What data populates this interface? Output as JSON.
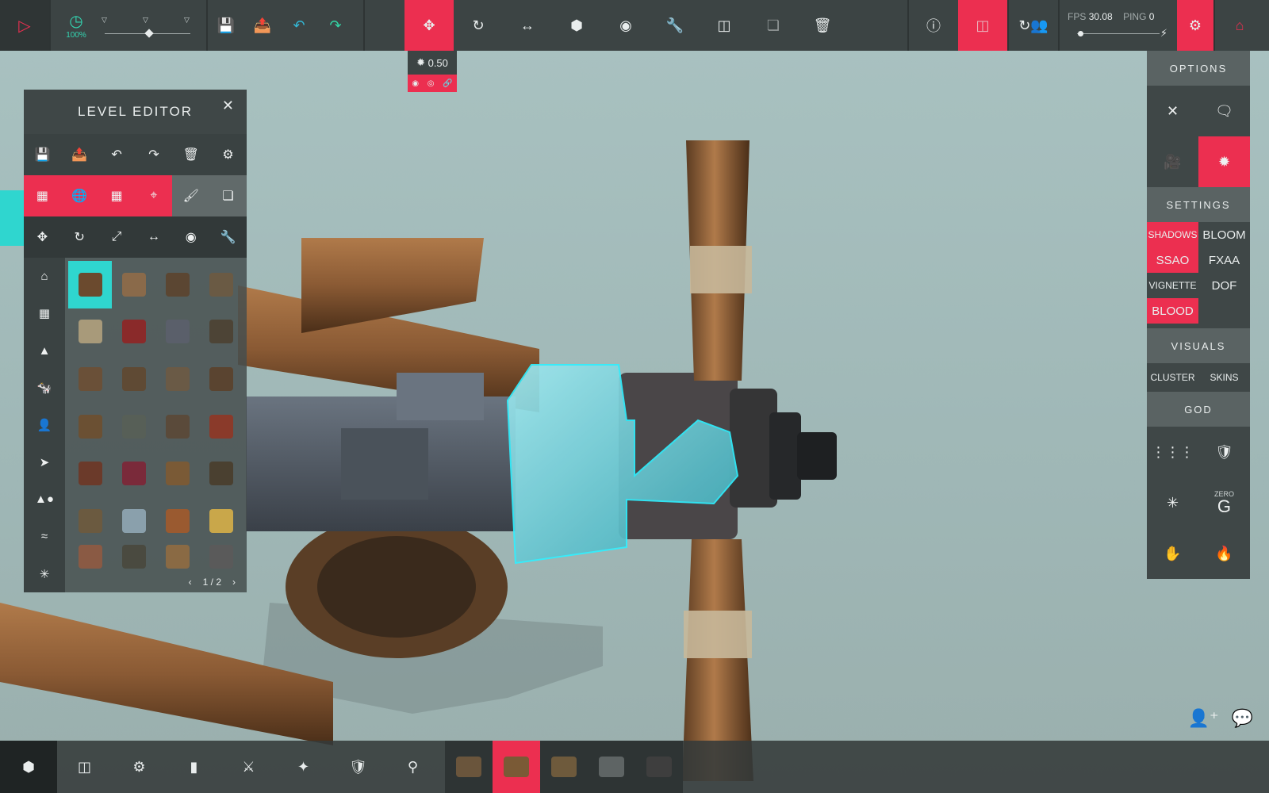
{
  "topbar": {
    "play_icon": "play-icon",
    "time_scale": "100%",
    "scale_value": "0.50",
    "fps_label": "FPS",
    "fps_value": "30.08",
    "ping_label": "PING",
    "ping_value": "0",
    "time_slider_level": 0.5,
    "fps_slider_level": 0.03
  },
  "level_editor": {
    "title": "LEVEL EDITOR",
    "page": "1 / 2"
  },
  "options": {
    "options_header": "OPTIONS",
    "settings_header": "SETTINGS",
    "visuals_header": "VISUALS",
    "god_header": "GOD",
    "shadows": "SHADOWS",
    "bloom": "BLOOM",
    "ssao": "SSAO",
    "fxaa": "FXAA",
    "vignette": "VIGNETTE",
    "dof": "DOF",
    "blood": "BLOOD",
    "cluster": "CLUSTER",
    "skins": "SKINS",
    "zero_label": "ZERO",
    "zero_g": "G"
  },
  "colors": {
    "accent": "#ec2f50",
    "panel": "#3f4747",
    "highlight": "#2fd6cf",
    "clock": "#33d6b2"
  },
  "thumb_colors": [
    "#6b4a2e",
    "#8a6a4a",
    "#5b4632",
    "#6a5a44",
    "#a89a7a",
    "#8a2a2a",
    "#5a5f6a",
    "#4d4436",
    "#6a5038",
    "#5f4a34",
    "#6a5a46",
    "#5a4430",
    "#6b5033",
    "#575f57",
    "#5a4a3a",
    "#8a3a2a",
    "#6b3a2a",
    "#7a2a3a",
    "#7a5a36",
    "#4a4030",
    "#6b5a40",
    "#8aa0ac",
    "#9a5a30",
    "#c9a74a",
    "#8a5a44",
    "#4a4a40",
    "#8a6a44",
    "#5a5a5a"
  ],
  "bottom_colors": [
    "#6a553c",
    "#7a5a36",
    "#6e5a3c",
    "#5e6464",
    "#3e3e3e"
  ]
}
